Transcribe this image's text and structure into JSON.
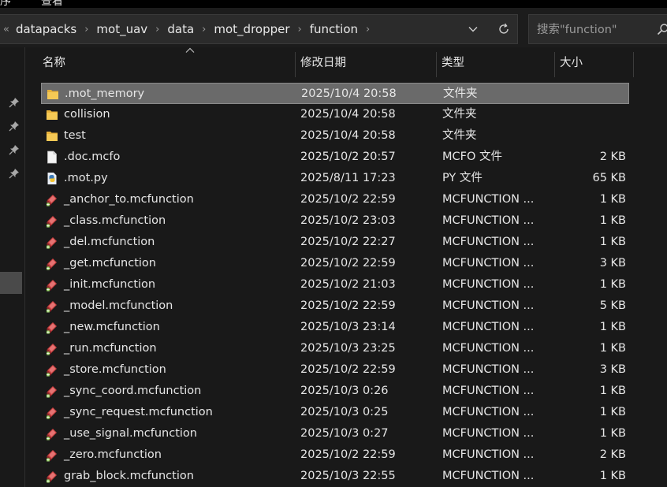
{
  "top_strip": {
    "left_text": "序",
    "mid_text": "查看"
  },
  "breadcrumb": {
    "lead": "«",
    "items": [
      "datapacks",
      "mot_uav",
      "data",
      "mot_dropper",
      "function"
    ]
  },
  "search": {
    "placeholder": "搜索\"function\""
  },
  "columns": {
    "name": "名称",
    "date": "修改日期",
    "type": "类型",
    "size": "大小"
  },
  "files": [
    {
      "name": ".mot_memory",
      "date": "2025/10/4 20:58",
      "type": "文件夹",
      "size": "",
      "icon": "folder-icon",
      "selected": true
    },
    {
      "name": "collision",
      "date": "2025/10/4 20:58",
      "type": "文件夹",
      "size": "",
      "icon": "folder-icon"
    },
    {
      "name": "test",
      "date": "2025/10/4 20:58",
      "type": "文件夹",
      "size": "",
      "icon": "folder-icon"
    },
    {
      "name": ".doc.mcfo",
      "date": "2025/10/2 20:57",
      "type": "MCFO 文件",
      "size": "2 KB",
      "icon": "document-icon"
    },
    {
      "name": ".mot.py",
      "date": "2025/8/11 17:23",
      "type": "PY 文件",
      "size": "65 KB",
      "icon": "python-icon"
    },
    {
      "name": "_anchor_to.mcfunction",
      "date": "2025/10/2 22:59",
      "type": "MCFUNCTION ...",
      "size": "1 KB",
      "icon": "mcfunction-icon"
    },
    {
      "name": "_class.mcfunction",
      "date": "2025/10/2 23:03",
      "type": "MCFUNCTION ...",
      "size": "1 KB",
      "icon": "mcfunction-icon"
    },
    {
      "name": "_del.mcfunction",
      "date": "2025/10/2 22:27",
      "type": "MCFUNCTION ...",
      "size": "1 KB",
      "icon": "mcfunction-icon"
    },
    {
      "name": "_get.mcfunction",
      "date": "2025/10/2 22:59",
      "type": "MCFUNCTION ...",
      "size": "3 KB",
      "icon": "mcfunction-icon"
    },
    {
      "name": "_init.mcfunction",
      "date": "2025/10/2 21:03",
      "type": "MCFUNCTION ...",
      "size": "1 KB",
      "icon": "mcfunction-icon"
    },
    {
      "name": "_model.mcfunction",
      "date": "2025/10/2 22:59",
      "type": "MCFUNCTION ...",
      "size": "5 KB",
      "icon": "mcfunction-icon"
    },
    {
      "name": "_new.mcfunction",
      "date": "2025/10/3 23:14",
      "type": "MCFUNCTION ...",
      "size": "1 KB",
      "icon": "mcfunction-icon"
    },
    {
      "name": "_run.mcfunction",
      "date": "2025/10/3 23:25",
      "type": "MCFUNCTION ...",
      "size": "1 KB",
      "icon": "mcfunction-icon"
    },
    {
      "name": "_store.mcfunction",
      "date": "2025/10/2 22:59",
      "type": "MCFUNCTION ...",
      "size": "3 KB",
      "icon": "mcfunction-icon"
    },
    {
      "name": "_sync_coord.mcfunction",
      "date": "2025/10/3 0:26",
      "type": "MCFUNCTION ...",
      "size": "1 KB",
      "icon": "mcfunction-icon"
    },
    {
      "name": "_sync_request.mcfunction",
      "date": "2025/10/3 0:25",
      "type": "MCFUNCTION ...",
      "size": "1 KB",
      "icon": "mcfunction-icon"
    },
    {
      "name": "_use_signal.mcfunction",
      "date": "2025/10/3 0:27",
      "type": "MCFUNCTION ...",
      "size": "1 KB",
      "icon": "mcfunction-icon"
    },
    {
      "name": "_zero.mcfunction",
      "date": "2025/10/2 22:59",
      "type": "MCFUNCTION ...",
      "size": "2 KB",
      "icon": "mcfunction-icon"
    },
    {
      "name": "grab_block.mcfunction",
      "date": "2025/10/3 22:55",
      "type": "MCFUNCTION ...",
      "size": "1 KB",
      "icon": "mcfunction-icon"
    }
  ],
  "colors": {
    "background": "#191919",
    "selected_row": "#6a6a6a",
    "folder": "#f2c14e",
    "text": "#e6e6e6"
  }
}
